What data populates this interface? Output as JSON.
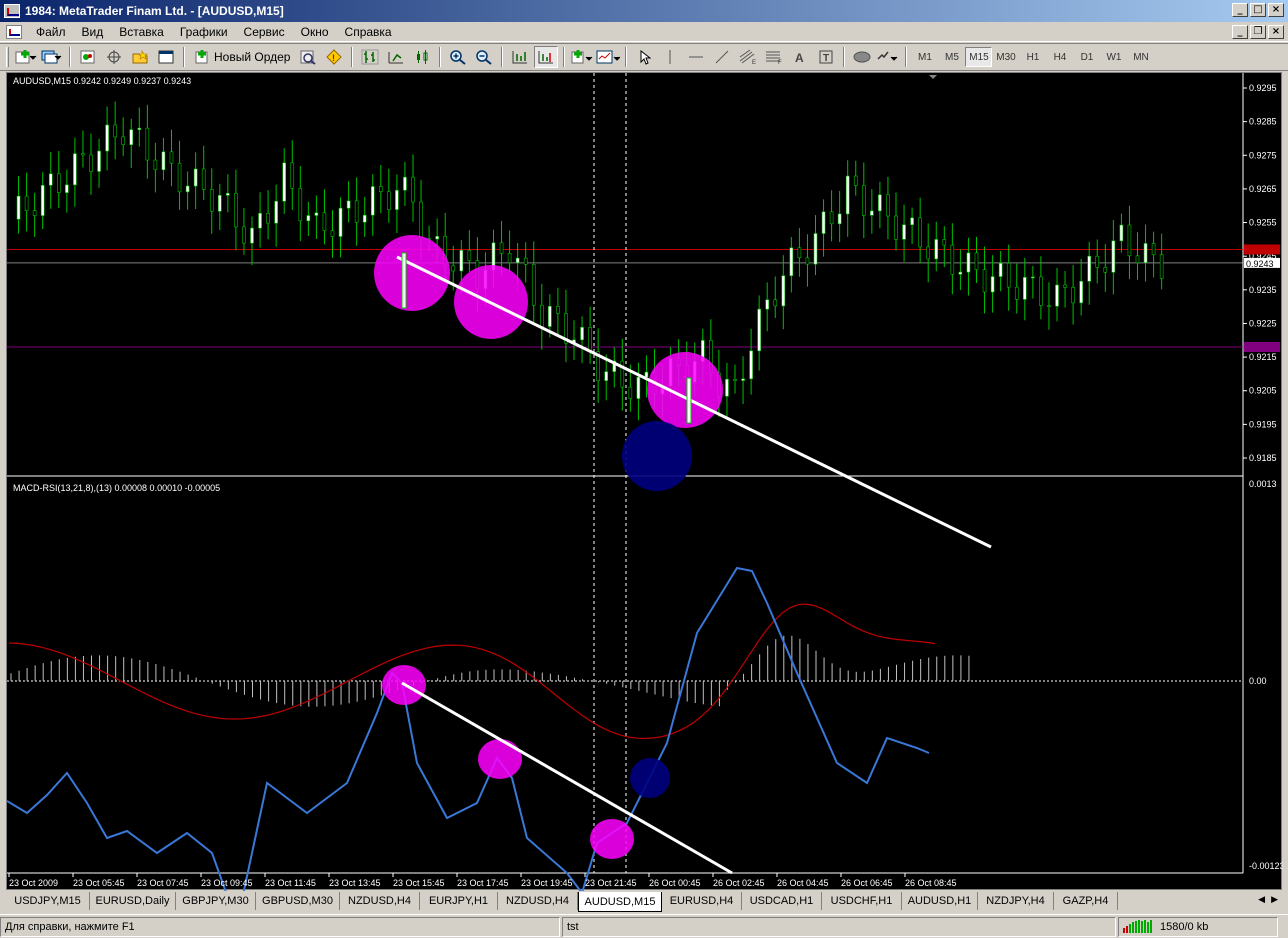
{
  "window": {
    "title": "1984: MetaTrader Finam Ltd. - [AUDUSD,M15]"
  },
  "menu": [
    "Файл",
    "Вид",
    "Вставка",
    "Графики",
    "Сервис",
    "Окно",
    "Справка"
  ],
  "toolbar": {
    "new_order_label": "Новый Ордер",
    "timeframes": [
      "M1",
      "M5",
      "M15",
      "M30",
      "H1",
      "H4",
      "D1",
      "W1",
      "MN"
    ],
    "active_timeframe": "M15"
  },
  "chart": {
    "symbol_info": "AUDUSD,M15  0.9242 0.9249 0.9237 0.9243",
    "indicator_info": "MACD-RSI(13,21,8),(13) 0.00008 0.00010 -0.00005",
    "price_ticks": [
      "0.9295",
      "0.9285",
      "0.9275",
      "0.9265",
      "0.9255",
      "0.9245",
      "0.9235",
      "0.9225",
      "0.9215",
      "0.9205",
      "0.9195",
      "0.9185"
    ],
    "price_markers": [
      {
        "value": 0.9247,
        "label": "",
        "color": "#c00000"
      },
      {
        "value": 0.9243,
        "label": "0.9243",
        "color": "#ffffff"
      },
      {
        "value": 0.9218,
        "label": "",
        "color": "#800080"
      }
    ],
    "indicator_ticks": [
      "0.0013",
      "0.00",
      "-0.00123"
    ],
    "time_labels": [
      "23 Oct 2009",
      "23 Oct 05:45",
      "23 Oct 07:45",
      "23 Oct 09:45",
      "23 Oct 11:45",
      "23 Oct 13:45",
      "23 Oct 15:45",
      "23 Oct 17:45",
      "23 Oct 19:45",
      "23 Oct 21:45",
      "26 Oct 00:45",
      "26 Oct 02:45",
      "26 Oct 04:45",
      "26 Oct 06:45",
      "26 Oct 08:45"
    ],
    "colors": {
      "bull_candle": "#ffffff",
      "bear_candle": "#000000",
      "wick": "#00c000",
      "highlight_pink": "#ff00ff",
      "highlight_blue": "#000080",
      "trendline": "#ffffff",
      "macd_line": "#3a78d8",
      "signal_line": "#c00000",
      "histogram": "#c0c0c0"
    }
  },
  "tabs": [
    "USDJPY,M15",
    "EURUSD,Daily",
    "GBPJPY,M30",
    "GBPUSD,M30",
    "NZDUSD,H4",
    "EURJPY,H1",
    "NZDUSD,H4",
    "AUDUSD,M15",
    "EURUSD,H4",
    "USDCAD,H1",
    "USDCHF,H1",
    "AUDUSD,H1",
    "NZDJPY,H4",
    "GAZP,H4"
  ],
  "active_tab": "AUDUSD,M15",
  "status": {
    "help": "Для справки, нажмите F1",
    "profile": "tst",
    "traffic": "1580/0 kb"
  }
}
